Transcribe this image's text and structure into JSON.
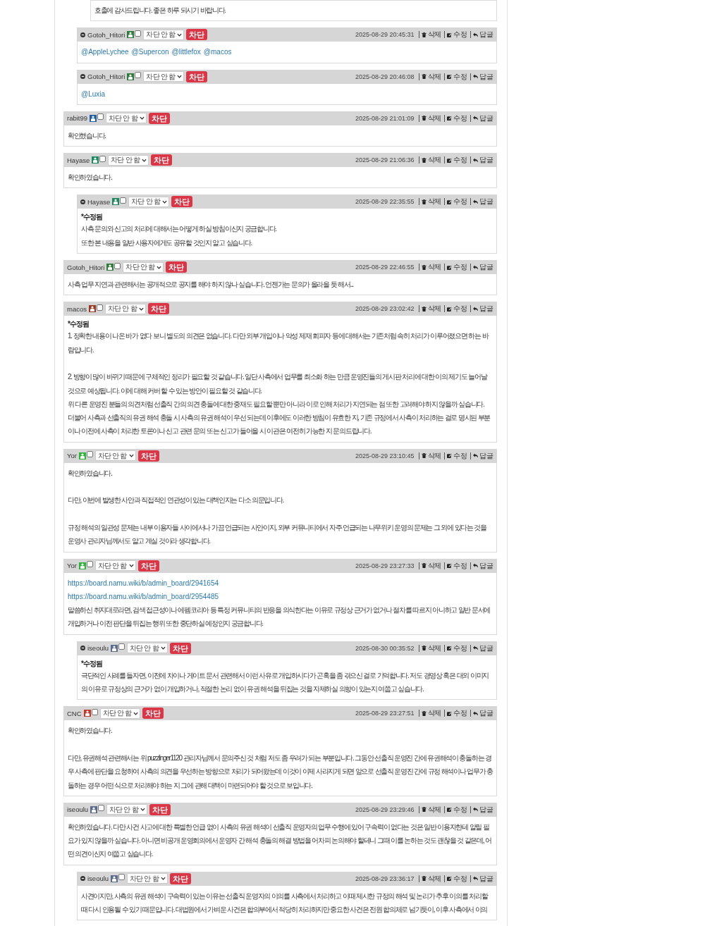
{
  "comments": [
    {
      "children": [
        {
          "children": [
            {
              "body": [
                [
                  {
                    "kind": "text",
                    "text": "호출에 감사드립니다. 좋은 하루 되시기 바랍니다."
                  }
                ]
              ]
            }
          ]
        },
        {
          "author": "Gotoh_Hitori",
          "color": "#2e7d3a",
          "checked": false,
          "block_select": "차단 안 함",
          "block_button": "차단",
          "date": "2025-08-29 20:45:31",
          "actions": [
            {
              "kind": "delete",
              "label": "삭제"
            },
            {
              "kind": "edit",
              "label": "수정"
            },
            {
              "kind": "reply",
              "label": "답글"
            }
          ],
          "body": [
            [
              {
                "kind": "mentions",
                "links": [
                  "@AppleLychee",
                  "@Supercon",
                  "@littlefox",
                  "@macos"
                ]
              }
            ]
          ]
        },
        {
          "author": "Gotoh_Hitori",
          "color": "#2e7d3a",
          "checked": false,
          "block_select": "차단 안 함",
          "block_button": "차단",
          "date": "2025-08-29 20:46:08",
          "actions": [
            {
              "kind": "delete",
              "label": "삭제"
            },
            {
              "kind": "edit",
              "label": "수정"
            },
            {
              "kind": "reply",
              "label": "답글"
            }
          ],
          "body": [
            [
              {
                "kind": "mentions",
                "links": [
                  "@Luxia"
                ]
              }
            ]
          ]
        }
      ]
    },
    {
      "author": "rabit99",
      "color": "#1f5fa8",
      "checked": false,
      "block_select": "차단 안 함",
      "block_button": "차단",
      "date": "2025-08-29 21:01:09",
      "actions": [
        {
          "kind": "delete",
          "label": "삭제"
        },
        {
          "kind": "edit",
          "label": "수정"
        },
        {
          "kind": "reply",
          "label": "답글"
        }
      ],
      "body": [
        [
          {
            "kind": "text",
            "text": "확인했습니다."
          }
        ]
      ]
    },
    {
      "author": "Hayase",
      "color": "#1b8a5e",
      "checked": false,
      "block_select": "차단 안 함",
      "block_button": "차단",
      "date": "2025-08-29 21:06:36",
      "actions": [
        {
          "kind": "delete",
          "label": "삭제"
        },
        {
          "kind": "edit",
          "label": "수정"
        },
        {
          "kind": "reply",
          "label": "답글"
        }
      ],
      "body": [
        [
          {
            "kind": "text",
            "text": "확인하였습니다."
          }
        ]
      ],
      "children": [
        {
          "author": "Hayase",
          "color": "#1b8a5e",
          "checked": false,
          "block_select": "차단 안 함",
          "block_button": "차단",
          "date": "2025-08-29 22:35:55",
          "actions": [
            {
              "kind": "delete",
              "label": "삭제"
            },
            {
              "kind": "edit",
              "label": "수정"
            },
            {
              "kind": "reply",
              "label": "답글"
            }
          ],
          "edited_note": "*수정됨",
          "body": [
            [
              {
                "kind": "text",
                "text": "사측 문의와 신고의 처리에 대해서는 어떻게 하실 방침이신지 궁금합니다."
              },
              {
                "kind": "text",
                "text": "또한 본 내용을 일반 사용자에게도 공유할 것인지 알고 싶습니다."
              }
            ]
          ]
        }
      ]
    },
    {
      "author": "Gotoh_Hitori",
      "color": "#2e7d3a",
      "checked": false,
      "block_select": "차단 안 함",
      "block_button": "차단",
      "date": "2025-08-29 22:46:55",
      "actions": [
        {
          "kind": "delete",
          "label": "삭제"
        },
        {
          "kind": "edit",
          "label": "수정"
        },
        {
          "kind": "reply",
          "label": "답글"
        }
      ],
      "body": [
        [
          {
            "kind": "text",
            "text": "사측 업무 지연과 관련해서는 공개적으로 공지를 해야 하지 않나 싶습니다. 언젠가는 문의가 올라올 듯 해서..."
          }
        ]
      ]
    },
    {
      "author": "macos",
      "color": "#9a3a26",
      "checked": false,
      "block_select": "차단 안 함",
      "block_button": "차단",
      "date": "2025-08-29 23:02:42",
      "actions": [
        {
          "kind": "delete",
          "label": "삭제"
        },
        {
          "kind": "edit",
          "label": "수정"
        },
        {
          "kind": "reply",
          "label": "답글"
        }
      ],
      "edited_note": "*수정됨",
      "body": [
        [
          {
            "kind": "text",
            "text": "1. 정확한 내용이 나온 바가 없다 보니 별도의 의견은 없습니다. 다만 외부 개입이나 악성 제재 회피자 등에 대해서는 기존처럼 속히 처리가 이루어졌으면 하는 바람입니다."
          }
        ],
        [
          {
            "kind": "text",
            "text": "2. 방향이 많이 바뀌기 때문에 구체적인 정리가 필요할 것 같습니다. 일단 사측에서 업무를 최소화 하는 만큼 운영진들의 게시판 처리에 대한 이의 제기도 늘어날 것으로 예상됩니다. 이에 대해 커버 할 수 있는 방안이 필요할 것 같습니다."
          },
          {
            "kind": "text",
            "text": "위 다른 운영진 분들의 의견처럼 선출직 간의 의견 충돌에 대한 중재도 필요할 뿐만 아니라 이로 인해 처리가 지연되는 점 또한 고려해야 하지 않을까 싶습니다."
          },
          {
            "kind": "text",
            "text": "더불어 사측과 선출직의 유권 해석 충돌 시 사측의 유권 해석이 우선 되는데 이후에도 이러한 방침이 유효한 지, 기존 규정에서 사측이 처리하는 걸로 명시된 부분이나 이전에 사측이 처리한 토론이나 신고 관련 문의 또는 신고가 들어올 시 이관은 여전히 가능한 지 문의드립니다."
          }
        ]
      ]
    },
    {
      "author": "Yor",
      "color": "#2fb33a",
      "checked": false,
      "block_select": "차단 안 함",
      "block_button": "차단",
      "date": "2025-08-29 23:10:45",
      "actions": [
        {
          "kind": "delete",
          "label": "삭제"
        },
        {
          "kind": "edit",
          "label": "수정"
        },
        {
          "kind": "reply",
          "label": "답글"
        }
      ],
      "body": [
        [
          {
            "kind": "text",
            "text": "확인하였습니다."
          }
        ],
        [
          {
            "kind": "text",
            "text": "다만, 이번에 발생한 사안과 직접적인 연관성이 있는 대책인지는 다소 의문입니다."
          }
        ],
        [
          {
            "kind": "text",
            "text": "규정 해석의 일관성 문제는 내부 이용자들 사이에서나 가끔 언급되는 사안이지, 외부 커뮤니티에서 자주 언급되는 나무위키 운영의 문제는 그 외에 있다는 것을 운영사 관리자님께서도 알고 계실 것이라 생각합니다."
          }
        ]
      ]
    },
    {
      "author": "Yor",
      "color": "#2fb33a",
      "checked": false,
      "block_select": "차단 안 함",
      "block_button": "차단",
      "date": "2025-08-29 23:27:33",
      "actions": [
        {
          "kind": "delete",
          "label": "삭제"
        },
        {
          "kind": "edit",
          "label": "수정"
        },
        {
          "kind": "reply",
          "label": "답글"
        }
      ],
      "body": [
        [
          {
            "kind": "link",
            "text": "https://board.namu.wiki/b/admin_board/2941654"
          },
          {
            "kind": "link",
            "text": "https://board.namu.wiki/b/admin_board/2954485"
          },
          {
            "kind": "text",
            "text": "말씀하신 취지대로라면, 검색 접근성이나 에펨코리아 등 특정 커뮤니티의 반응을 의식한다는 이유로 규정상 근거가 없거나 절차를 따르지 아니하고 일반 문서에 개입하거나 이전 판단을 뒤집는 행위 또한 중단하실 예정인지 궁금합니다."
          }
        ]
      ],
      "children": [
        {
          "author": "iseoulu",
          "color": "#5a6b8e",
          "checked": false,
          "block_select": "차단 안 함",
          "block_button": "차단",
          "date": "2025-08-30 00:35:52",
          "actions": [
            {
              "kind": "delete",
              "label": "삭제"
            },
            {
              "kind": "edit",
              "label": "수정"
            },
            {
              "kind": "reply",
              "label": "답글"
            }
          ],
          "edited_note": "*수정됨",
          "body": [
            [
              {
                "kind": "text",
                "text": "극단적인 사례를 들자면, 이전에 차이나 게이트 문서 관련해서 이런 사유로 개입하시다가 곤혹을 좀 겪으신 걸로 기억합니다. 저도 경영상 혹은 대외 이미지의 이유로 규정상의 근거가 없이 개입하거나, 적절한 논리 없이 유권 해석을 뒤집는 것을 자제하실 의향이 있는지 여쭙고 싶습니다."
              }
            ]
          ]
        }
      ]
    },
    {
      "author": "CNC",
      "color": "#c8372b",
      "checked": false,
      "block_select": "차단 안 함",
      "block_button": "차단",
      "date": "2025-08-29 23:27:51",
      "actions": [
        {
          "kind": "delete",
          "label": "삭제"
        },
        {
          "kind": "edit",
          "label": "수정"
        },
        {
          "kind": "reply",
          "label": "답글"
        }
      ],
      "body": [
        [
          {
            "kind": "text",
            "text": "확인하였습니다."
          }
        ],
        [
          {
            "kind": "text",
            "text": "다만, 유권해석 관련해서는 위 puzzlinger1120 관리자님께서 문의주신 것 처럼 저도 좀 우려가 되는 부분입니다. 그동안 선출직 운영진 간에 유권해석이 충돌하는 경우 사측에 판단을 요청하여 사측의 의견을 우선하는 방향으로 처리가 되어왔는데 이것이 이제 사라지게 되면 앞으로 선출직 운영진 간에 규정 해석이나 업무가 충돌하는 경우 어떤 식으로 처리해야 하는 지 그에 관해 대책이 마련되어야 할 것으로 보입니다."
          }
        ]
      ]
    },
    {
      "author": "iseoulu",
      "color": "#5a6b8e",
      "checked": false,
      "block_select": "차단 안 함",
      "block_button": "차단",
      "date": "2025-08-29 23:29:46",
      "actions": [
        {
          "kind": "delete",
          "label": "삭제"
        },
        {
          "kind": "edit",
          "label": "수정"
        },
        {
          "kind": "reply",
          "label": "답글"
        }
      ],
      "body": [
        [
          {
            "kind": "text",
            "text": "확인하였습니다. 다만 사건 사고에 대한 특별한 언급 없이 사측의 유권 해석이 선출직 운영자의 업무 수행에 있어 구속력이 없다는 것은 일반 이용자한테 알릴 필요가 있지 않을까 싶습니다. 아니면 비공개 운영회의에서 운영자 간 해석 충돌의 해결 방법을 어차피 논의해야 할테니 그때 이를 논하는 것도 괜찮을 것 같은데, 어떤 의견이신지 여쭙고 싶습니다."
          }
        ]
      ],
      "children": [
        {
          "author": "iseoulu",
          "color": "#5a6b8e",
          "checked": false,
          "block_select": "차단 안 함",
          "block_button": "차단",
          "date": "2025-08-29 23:36:17",
          "actions": [
            {
              "kind": "delete",
              "label": "삭제"
            },
            {
              "kind": "edit",
              "label": "수정"
            },
            {
              "kind": "reply",
              "label": "답글"
            }
          ],
          "body": [
            [
              {
                "kind": "text",
                "text": "사견이지만, 사측의 유권 해석이 구속력이 있는 이유는 선출직 운영자의 이의를 사측에서 처리하고 이때 제시한 규정의 해석 및 논리가 추후 이의를 처리할 때 다시 인용될 수 있기 때문입니다. 대법원에서 가벼운 사건은 합의부에서 적당히 처리하지만 중요한 사건은 전원 합의체로 넘기듯이, 이후 사측에서 이의"
              }
            ]
          ]
        }
      ]
    }
  ]
}
